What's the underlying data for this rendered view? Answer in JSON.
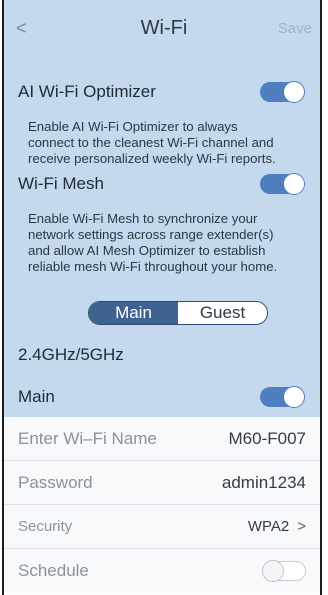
{
  "header": {
    "back": "<",
    "title": "Wi-Fi",
    "save": "Save"
  },
  "ai_optimizer": {
    "label": "AI Wi-Fi Optimizer",
    "enabled": true,
    "description": [
      "Enable AI Wi-Fi Optimizer to always",
      "connect to the cleanest Wi-Fi channel and",
      "receive personalized weekly Wi-Fi reports."
    ]
  },
  "mesh": {
    "label": "Wi-Fi Mesh",
    "enabled": true,
    "description": [
      "Enable Wi-Fi Mesh to synchronize your",
      "network settings across range extender(s)",
      "and allow AI Mesh Optimizer to establish",
      "reliable mesh Wi-Fi throughout your home."
    ]
  },
  "network_tabs": {
    "main": "Main",
    "guest": "Guest",
    "selected": "Main"
  },
  "band": {
    "label": "2.4GHz/5GHz"
  },
  "main_toggle": {
    "label": "Main",
    "enabled": true
  },
  "fields": {
    "name": {
      "label": "Enter Wi–Fi Name",
      "value": "M60-F007"
    },
    "password": {
      "label": "Password",
      "value": "admin1234"
    },
    "security": {
      "label": "Security",
      "value": "WPA2",
      "chevron": ">"
    },
    "schedule": {
      "label": "Schedule",
      "enabled": false
    }
  },
  "colors": {
    "panel": "#c4d9ee",
    "accent": "#4f7fbf",
    "segment_active": "#3f6390"
  }
}
